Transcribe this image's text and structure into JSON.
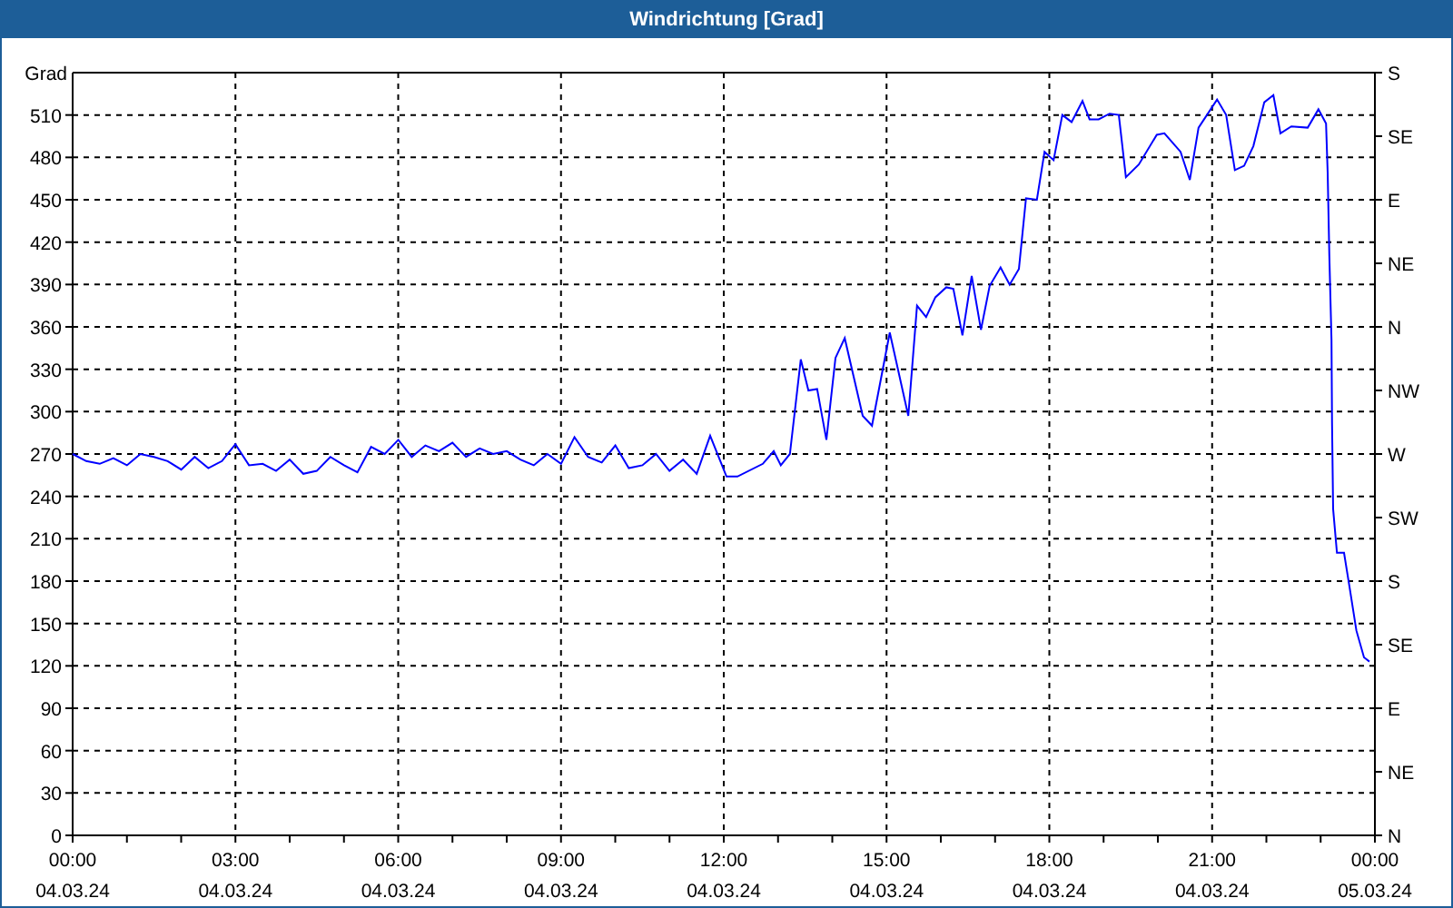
{
  "window": {
    "title": "Windrichtung [Grad]"
  },
  "chart": {
    "chart_data": {
      "type": "line",
      "grid": true,
      "ylabel": "Grad",
      "x": [
        0,
        0.25,
        0.5,
        0.75,
        1,
        1.25,
        1.5,
        1.75,
        2,
        2.25,
        2.5,
        2.75,
        3,
        3.25,
        3.5,
        3.75,
        4,
        4.25,
        4.5,
        4.75,
        5,
        5.25,
        5.5,
        5.75,
        6,
        6.25,
        6.5,
        6.75,
        7,
        7.25,
        7.5,
        7.75,
        8,
        8.25,
        8.5,
        8.75,
        9,
        9.25,
        9.5,
        9.75,
        10,
        10.25,
        10.5,
        10.75,
        11,
        11.25,
        11.5,
        11.75,
        12.05,
        12.25,
        12.72,
        12.92,
        13.05,
        13.22,
        13.42,
        13.56,
        13.72,
        13.89,
        14.06,
        14.23,
        14.56,
        14.73,
        15.06,
        15.4,
        15.56,
        15.73,
        15.9,
        16.1,
        16.23,
        16.4,
        16.57,
        16.74,
        16.9,
        17.1,
        17.27,
        17.44,
        17.57,
        17.77,
        17.91,
        18.08,
        18.24,
        18.41,
        18.61,
        18.74,
        18.91,
        19.11,
        19.28,
        19.41,
        19.65,
        19.98,
        20.12,
        20.42,
        20.59,
        20.75,
        21.09,
        21.26,
        21.42,
        21.59,
        21.76,
        21.96,
        22.13,
        22.26,
        22.46,
        22.76,
        22.96,
        23.1,
        23.13,
        23.16,
        23.2,
        23.21,
        23.23,
        23.3,
        23.43,
        23.53,
        23.66,
        23.8,
        23.9
      ],
      "values": [
        270,
        265,
        263,
        267,
        262,
        270,
        268,
        265,
        259,
        268,
        260,
        265,
        277,
        262,
        263,
        258,
        266,
        256,
        258,
        268,
        262,
        257,
        275,
        270,
        280,
        268,
        276,
        272,
        278,
        268,
        274,
        270,
        272,
        266,
        262,
        270,
        263,
        282,
        268,
        264,
        276,
        260,
        262,
        270,
        258,
        266,
        256,
        283,
        254,
        254,
        263,
        272,
        262,
        270,
        337,
        315,
        316,
        280,
        338,
        352,
        297,
        290,
        356,
        297,
        375,
        367,
        381,
        388,
        387,
        354,
        396,
        358,
        389,
        402,
        390,
        401,
        451,
        450,
        484,
        478,
        510,
        505,
        520,
        507,
        507,
        511,
        510,
        466,
        475,
        496,
        497,
        484,
        464,
        501,
        521,
        510,
        471,
        474,
        488,
        519,
        524,
        497,
        502,
        501,
        514,
        504,
        469,
        411,
        351,
        292,
        231,
        200,
        200,
        176,
        145,
        126,
        123
      ],
      "xlim": [
        0,
        24
      ],
      "ylim": [
        0,
        540
      ],
      "xticks": [
        {
          "value": 0,
          "label": "00:00"
        },
        {
          "value": 3,
          "label": "03:00"
        },
        {
          "value": 6,
          "label": "06:00"
        },
        {
          "value": 9,
          "label": "09:00"
        },
        {
          "value": 12,
          "label": "12:00"
        },
        {
          "value": 15,
          "label": "15:00"
        },
        {
          "value": 18,
          "label": "18:00"
        },
        {
          "value": 21,
          "label": "21:00"
        },
        {
          "value": 24,
          "label": "00:00"
        }
      ],
      "yticks": [
        0,
        30,
        60,
        90,
        120,
        150,
        180,
        210,
        240,
        270,
        300,
        330,
        360,
        390,
        420,
        450,
        480,
        510
      ]
    },
    "x_dates": [
      "04.03.24",
      "04.03.24",
      "04.03.24",
      "04.03.24",
      "04.03.24",
      "04.03.24",
      "04.03.24",
      "04.03.24",
      "05.03.24"
    ],
    "compass_labels": [
      "S",
      "SE",
      "E",
      "NE",
      "N",
      "NW",
      "W",
      "SW",
      "S",
      "SE",
      "E",
      "NE",
      "N"
    ]
  }
}
